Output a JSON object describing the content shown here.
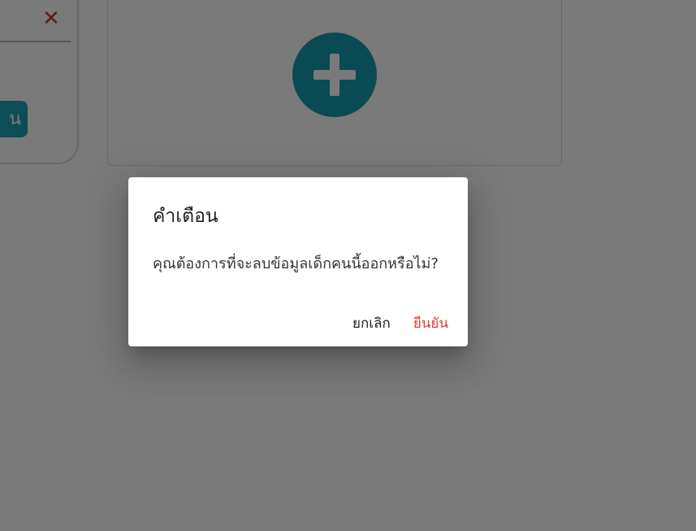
{
  "background": {
    "left_card": {
      "close_icon": "close-icon",
      "button_label": "น"
    },
    "add_card": {
      "add_icon": "plus-icon"
    }
  },
  "dialog": {
    "title": "คำเตือน",
    "message": "คุณต้องการที่จะลบข้อมูลเด็กคนนี้ออกหรือไม่?",
    "cancel_label": "ยกเลิก",
    "confirm_label": "ยืนยัน"
  },
  "colors": {
    "accent": "#149bb0",
    "danger": "#e53935",
    "overlay": "rgba(0,0,0,0.52)"
  }
}
